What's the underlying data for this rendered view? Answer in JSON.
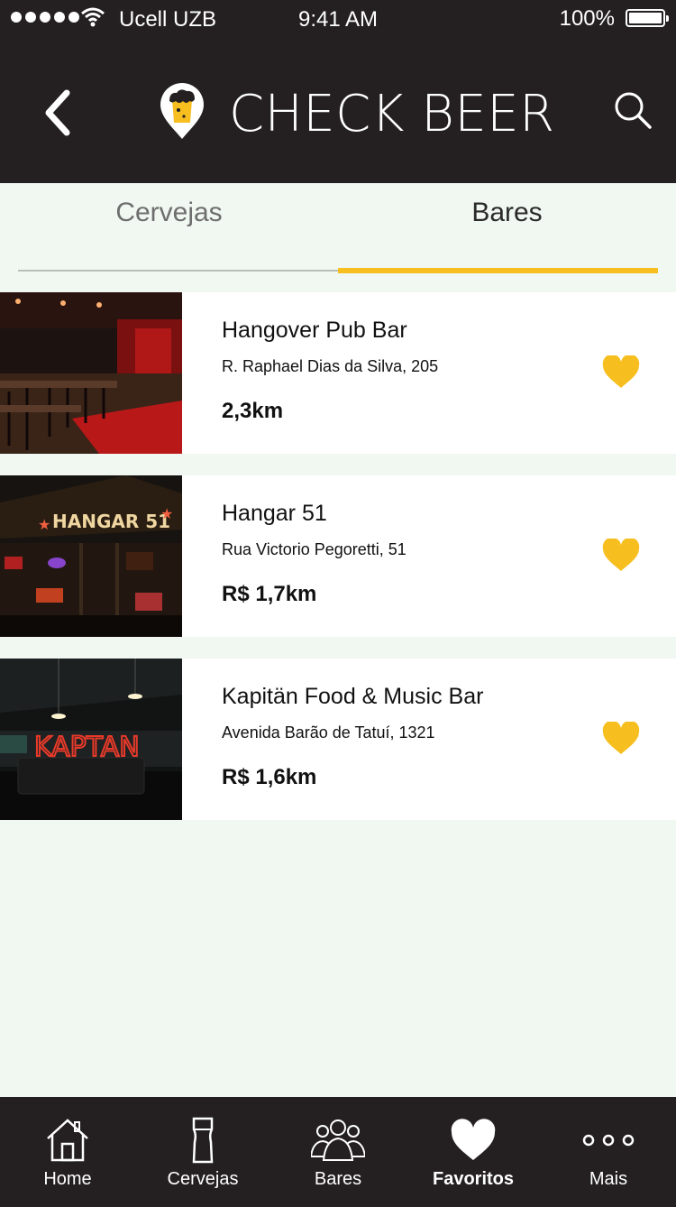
{
  "status_bar": {
    "carrier": "Ucell UZB",
    "time": "9:41 AM",
    "battery": "100%"
  },
  "header": {
    "title": "CHECK BEER"
  },
  "tabs": [
    {
      "label": "Cervejas",
      "active": false
    },
    {
      "label": "Bares",
      "active": true
    }
  ],
  "bars": [
    {
      "name": "Hangover Pub Bar",
      "address": "R. Raphael Dias da Silva, 205",
      "distance": "2,3km"
    },
    {
      "name": "Hangar 51",
      "address": "Rua Victorio Pegoretti, 51",
      "distance": "R$ 1,7km",
      "sign_text": "HANGAR 51"
    },
    {
      "name": "Kapitän Food & Music Bar",
      "address": "Avenida Barão de Tatuí, 1321",
      "distance": "R$ 1,6km",
      "sign_text": "KAPTAN"
    }
  ],
  "bottom_nav": [
    {
      "label": "Home",
      "icon": "home-icon"
    },
    {
      "label": "Cervejas",
      "icon": "beer-glass-icon"
    },
    {
      "label": "Bares",
      "icon": "people-icon"
    },
    {
      "label": "Favoritos",
      "icon": "heart-icon",
      "active": true
    },
    {
      "label": "Mais",
      "icon": "more-icon"
    }
  ],
  "colors": {
    "accent": "#F6BE1E",
    "header_bg": "#242021",
    "page_bg": "#F1F8F1"
  }
}
